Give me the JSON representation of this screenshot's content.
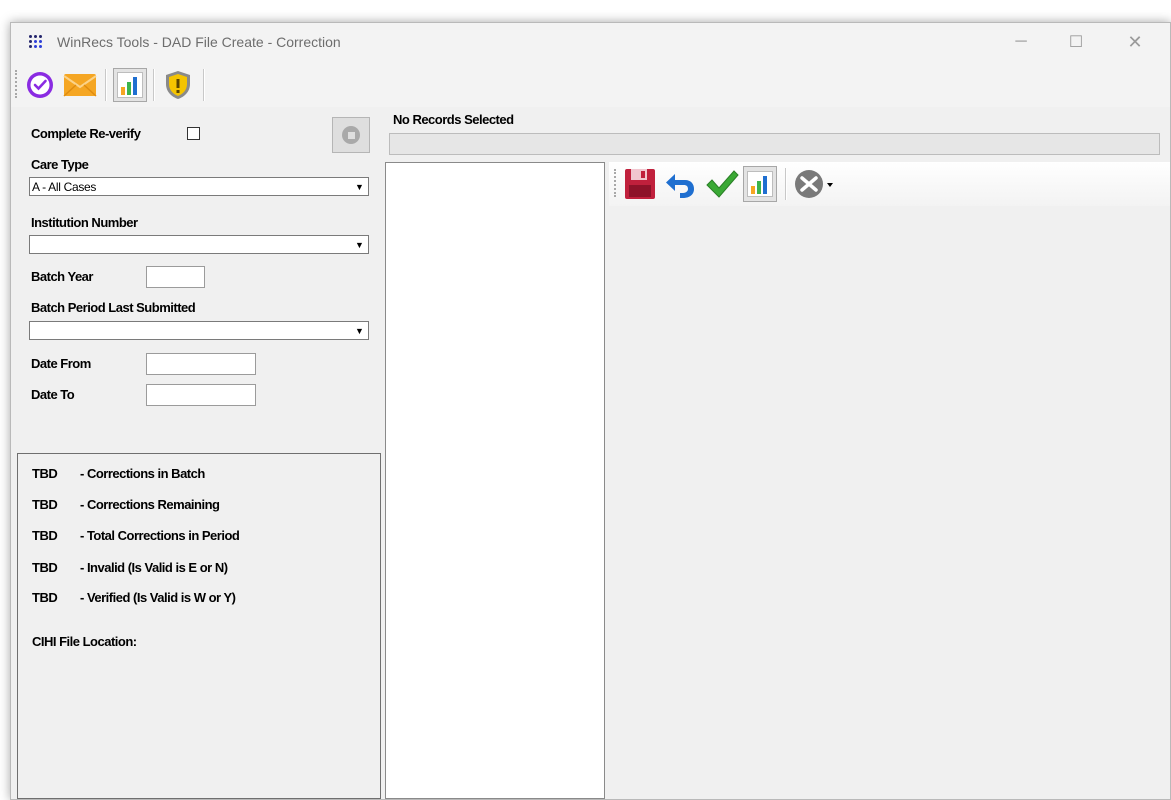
{
  "window": {
    "title": "WinRecs Tools - DAD File Create - Correction",
    "minimize_glyph": "─",
    "maximize_glyph": "☐",
    "close_glyph": "✕"
  },
  "toolbar": {
    "buttons": [
      {
        "icon": "verify-check-icon",
        "color": "#8a2be2"
      },
      {
        "icon": "mail-icon",
        "color": "#f5a623"
      },
      {
        "icon": "bar-chart-icon",
        "color": "#3cb44b"
      },
      {
        "icon": "shield-warning-icon",
        "color": "#f5c400"
      }
    ]
  },
  "filters": {
    "complete_reverify_label": "Complete Re-verify",
    "complete_reverify_checked": false,
    "care_type_label": "Care Type",
    "care_type_value": "A - All Cases",
    "institution_number_label": "Institution Number",
    "institution_number_value": "",
    "batch_year_label": "Batch Year",
    "batch_year_value": "",
    "batch_period_label": "Batch Period Last Submitted",
    "batch_period_value": "",
    "date_from_label": "Date From",
    "date_from_value": "",
    "date_to_label": "Date To",
    "date_to_value": "",
    "dropdown_arrow": "▼"
  },
  "stats": {
    "rows": [
      {
        "value": "TBD",
        "desc": "- Corrections in Batch"
      },
      {
        "value": "TBD",
        "desc": "- Corrections Remaining"
      },
      {
        "value": "TBD",
        "desc": "- Total Corrections in Period"
      },
      {
        "value": "TBD",
        "desc": "- Invalid (Is Valid is E or N)"
      },
      {
        "value": "TBD",
        "desc": "- Verified (Is Valid is W or Y)"
      }
    ],
    "cihi_label": "CIHI File Location:"
  },
  "records": {
    "status": "No Records Selected",
    "progress": 0
  },
  "detail_toolbar": {
    "buttons": [
      {
        "icon": "save-icon",
        "color": "#c0203c"
      },
      {
        "icon": "undo-icon",
        "color": "#1f6fd0"
      },
      {
        "icon": "checkmark-icon",
        "color": "#3aa935"
      },
      {
        "icon": "bar-chart-icon",
        "color": "#3cb44b"
      },
      {
        "icon": "tools-dropdown-icon",
        "color": "#7a7a7a"
      }
    ]
  }
}
